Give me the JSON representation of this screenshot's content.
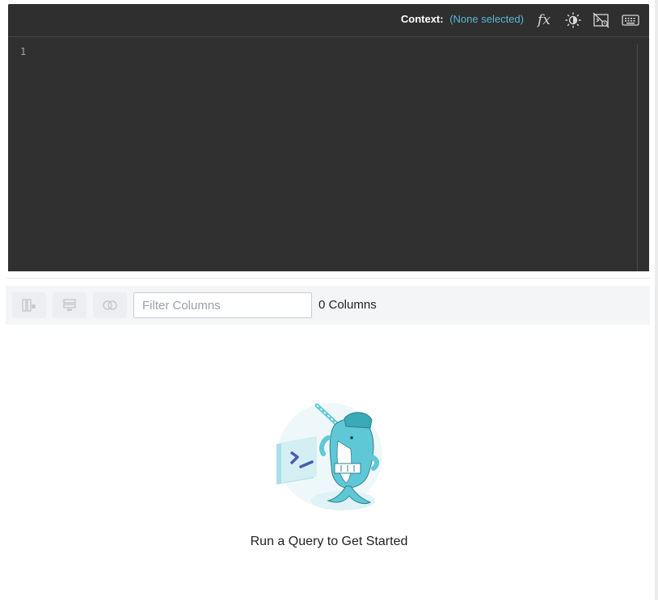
{
  "editor": {
    "context_label": "Context:",
    "context_value": "(None selected)",
    "line_numbers": [
      "1"
    ],
    "icons": [
      "function-icon",
      "theme-toggle-icon",
      "hide-results-icon",
      "keyboard-shortcuts-icon"
    ]
  },
  "results_toolbar": {
    "buttons": [
      "column-layout-icon",
      "row-layout-icon",
      "compare-icon"
    ],
    "filter_placeholder": "Filter Columns",
    "filter_value": "",
    "column_count": "0 Columns"
  },
  "empty_state": {
    "message": "Run a Query to Get Started",
    "illustration": "narwhal-terminal-illustration"
  },
  "colors": {
    "editor_bg": "#303030",
    "context_accent": "#56b9d6",
    "illustration_teal": "#5fc8d6"
  }
}
